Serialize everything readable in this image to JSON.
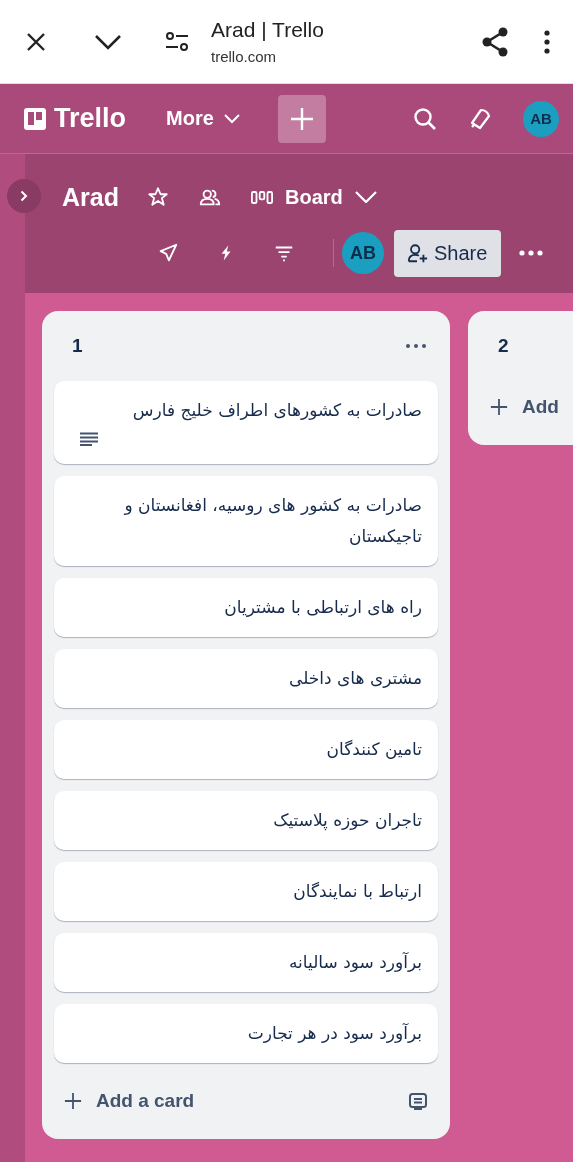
{
  "browser": {
    "title": "Arad | Trello",
    "url": "trello.com"
  },
  "app_header": {
    "logo": "Trello",
    "more": "More",
    "avatar": "AB"
  },
  "board_header": {
    "title": "Arad",
    "view": "Board",
    "avatar": "AB",
    "share": "Share"
  },
  "first_list": {
    "title": "1",
    "cards": [
      {
        "text": "صادرات به کشورهای اطراف خلیج فارس",
        "has_description": true
      },
      {
        "text": "صادرات به کشور های روسیه، افغانستان و تاجیکستان",
        "has_description": false
      },
      {
        "text": "راه های ارتباطی با مشتریان",
        "has_description": false
      },
      {
        "text": "مشتری های داخلی",
        "has_description": false
      },
      {
        "text": "تامین کنندگان",
        "has_description": false
      },
      {
        "text": "تاجران حوزه پلاستیک",
        "has_description": false
      },
      {
        "text": "ارتباط با نمایندگان",
        "has_description": false
      },
      {
        "text": "برآورد سود سالیانه",
        "has_description": false
      },
      {
        "text": "برآورد سود در هر تجارت",
        "has_description": false
      }
    ],
    "add_label": "Add a card"
  },
  "second_list": {
    "title": "2",
    "add_label": "Add"
  }
}
